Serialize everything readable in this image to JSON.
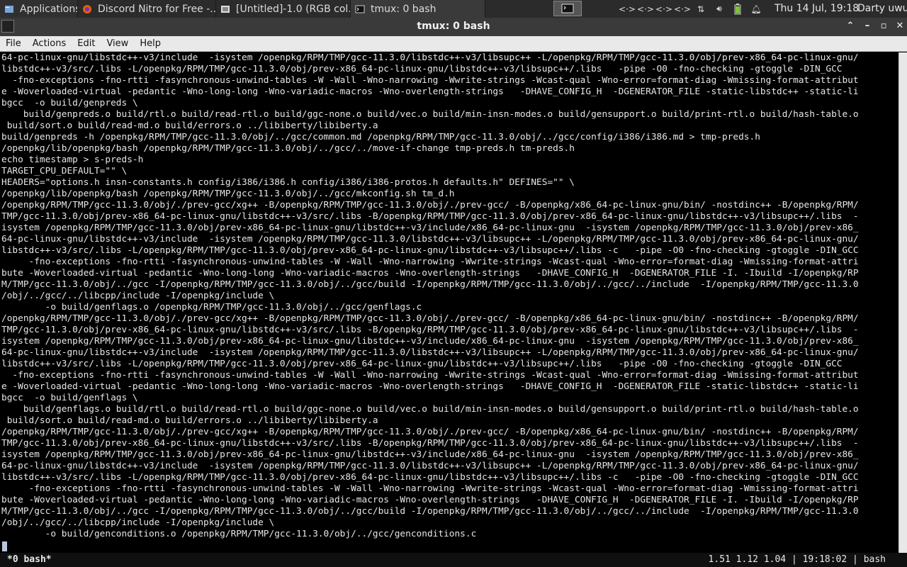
{
  "panel": {
    "apps_label": "Applications",
    "tasks": [
      {
        "label": "Discord Nitro for Free -..."
      },
      {
        "label": "[Untitled]-1.0 (RGB col..."
      },
      {
        "label": "tmux: 0 bash"
      }
    ],
    "clock": "Thu 14 Jul, 19:18",
    "user": "Darty uwu"
  },
  "window": {
    "title": "tmux: 0 bash",
    "menu": [
      "File",
      "Actions",
      "Edit",
      "View",
      "Help"
    ]
  },
  "terminal": {
    "lines": [
      "64-pc-linux-gnu/libstdc++-v3/include  -isystem /openpkg/RPM/TMP/gcc-11.3.0/libstdc++-v3/libsupc++ -L/openpkg/RPM/TMP/gcc-11.3.0/obj/prev-x86_64-pc-linux-gnu/",
      "libstdc++-v3/src/.libs -L/openpkg/RPM/TMP/gcc-11.3.0/obj/prev-x86_64-pc-linux-gnu/libstdc++-v3/libsupc++/.libs   -pipe -O0 -fno-checking -gtoggle -DIN_GCC",
      "  -fno-exceptions -fno-rtti -fasynchronous-unwind-tables -W -Wall -Wno-narrowing -Wwrite-strings -Wcast-qual -Wno-error=format-diag -Wmissing-format-attribut",
      "e -Woverloaded-virtual -pedantic -Wno-long-long -Wno-variadic-macros -Wno-overlength-strings   -DHAVE_CONFIG_H  -DGENERATOR_FILE -static-libstdc++ -static-li",
      "bgcc  -o build/genpreds \\",
      "    build/genpreds.o build/rtl.o build/read-rtl.o build/ggc-none.o build/vec.o build/min-insn-modes.o build/gensupport.o build/print-rtl.o build/hash-table.o",
      " build/sort.o build/read-md.o build/errors.o ../libiberty/libiberty.a",
      "build/genpreds -h /openpkg/RPM/TMP/gcc-11.3.0/obj/../gcc/common.md /openpkg/RPM/TMP/gcc-11.3.0/obj/../gcc/config/i386/i386.md > tmp-preds.h",
      "/openpkg/lib/openpkg/bash /openpkg/RPM/TMP/gcc-11.3.0/obj/../gcc/../move-if-change tmp-preds.h tm-preds.h",
      "echo timestamp > s-preds-h",
      "TARGET_CPU_DEFAULT=\"\" \\",
      "HEADERS=\"options.h insn-constants.h config/i386/i386.h config/i386/i386-protos.h defaults.h\" DEFINES=\"\" \\",
      "/openpkg/lib/openpkg/bash /openpkg/RPM/TMP/gcc-11.3.0/obj/../gcc/mkconfig.sh tm_d.h",
      "/openpkg/RPM/TMP/gcc-11.3.0/obj/./prev-gcc/xg++ -B/openpkg/RPM/TMP/gcc-11.3.0/obj/./prev-gcc/ -B/openpkg/x86_64-pc-linux-gnu/bin/ -nostdinc++ -B/openpkg/RPM/",
      "TMP/gcc-11.3.0/obj/prev-x86_64-pc-linux-gnu/libstdc++-v3/src/.libs -B/openpkg/RPM/TMP/gcc-11.3.0/obj/prev-x86_64-pc-linux-gnu/libstdc++-v3/libsupc++/.libs  -",
      "isystem /openpkg/RPM/TMP/gcc-11.3.0/obj/prev-x86_64-pc-linux-gnu/libstdc++-v3/include/x86_64-pc-linux-gnu  -isystem /openpkg/RPM/TMP/gcc-11.3.0/obj/prev-x86_",
      "64-pc-linux-gnu/libstdc++-v3/include  -isystem /openpkg/RPM/TMP/gcc-11.3.0/libstdc++-v3/libsupc++ -L/openpkg/RPM/TMP/gcc-11.3.0/obj/prev-x86_64-pc-linux-gnu/",
      "libstdc++-v3/src/.libs -L/openpkg/RPM/TMP/gcc-11.3.0/obj/prev-x86_64-pc-linux-gnu/libstdc++-v3/libsupc++/.libs -c   -pipe -O0 -fno-checking -gtoggle -DIN_GCC",
      "     -fno-exceptions -fno-rtti -fasynchronous-unwind-tables -W -Wall -Wno-narrowing -Wwrite-strings -Wcast-qual -Wno-error=format-diag -Wmissing-format-attri",
      "bute -Woverloaded-virtual -pedantic -Wno-long-long -Wno-variadic-macros -Wno-overlength-strings   -DHAVE_CONFIG_H  -DGENERATOR_FILE -I. -Ibuild -I/openpkg/RP",
      "M/TMP/gcc-11.3.0/obj/../gcc -I/openpkg/RPM/TMP/gcc-11.3.0/obj/../gcc/build -I/openpkg/RPM/TMP/gcc-11.3.0/obj/../gcc/../include  -I/openpkg/RPM/TMP/gcc-11.3.0",
      "/obj/../gcc/../libcpp/include -I/openpkg/include \\",
      "        -o build/genflags.o /openpkg/RPM/TMP/gcc-11.3.0/obj/../gcc/genflags.c",
      "/openpkg/RPM/TMP/gcc-11.3.0/obj/./prev-gcc/xg++ -B/openpkg/RPM/TMP/gcc-11.3.0/obj/./prev-gcc/ -B/openpkg/x86_64-pc-linux-gnu/bin/ -nostdinc++ -B/openpkg/RPM/",
      "TMP/gcc-11.3.0/obj/prev-x86_64-pc-linux-gnu/libstdc++-v3/src/.libs -B/openpkg/RPM/TMP/gcc-11.3.0/obj/prev-x86_64-pc-linux-gnu/libstdc++-v3/libsupc++/.libs  -",
      "isystem /openpkg/RPM/TMP/gcc-11.3.0/obj/prev-x86_64-pc-linux-gnu/libstdc++-v3/include/x86_64-pc-linux-gnu  -isystem /openpkg/RPM/TMP/gcc-11.3.0/obj/prev-x86_",
      "64-pc-linux-gnu/libstdc++-v3/include  -isystem /openpkg/RPM/TMP/gcc-11.3.0/libstdc++-v3/libsupc++ -L/openpkg/RPM/TMP/gcc-11.3.0/obj/prev-x86_64-pc-linux-gnu/",
      "libstdc++-v3/src/.libs -L/openpkg/RPM/TMP/gcc-11.3.0/obj/prev-x86_64-pc-linux-gnu/libstdc++-v3/libsupc++/.libs   -pipe -O0 -fno-checking -gtoggle -DIN_GCC",
      "  -fno-exceptions -fno-rtti -fasynchronous-unwind-tables -W -Wall -Wno-narrowing -Wwrite-strings -Wcast-qual -Wno-error=format-diag -Wmissing-format-attribut",
      "e -Woverloaded-virtual -pedantic -Wno-long-long -Wno-variadic-macros -Wno-overlength-strings   -DHAVE_CONFIG_H  -DGENERATOR_FILE -static-libstdc++ -static-li",
      "bgcc  -o build/genflags \\",
      "    build/genflags.o build/rtl.o build/read-rtl.o build/ggc-none.o build/vec.o build/min-insn-modes.o build/gensupport.o build/print-rtl.o build/hash-table.o",
      " build/sort.o build/read-md.o build/errors.o ../libiberty/libiberty.a",
      "/openpkg/RPM/TMP/gcc-11.3.0/obj/./prev-gcc/xg++ -B/openpkg/RPM/TMP/gcc-11.3.0/obj/./prev-gcc/ -B/openpkg/x86_64-pc-linux-gnu/bin/ -nostdinc++ -B/openpkg/RPM/",
      "TMP/gcc-11.3.0/obj/prev-x86_64-pc-linux-gnu/libstdc++-v3/src/.libs -B/openpkg/RPM/TMP/gcc-11.3.0/obj/prev-x86_64-pc-linux-gnu/libstdc++-v3/libsupc++/.libs  -",
      "isystem /openpkg/RPM/TMP/gcc-11.3.0/obj/prev-x86_64-pc-linux-gnu/libstdc++-v3/include/x86_64-pc-linux-gnu  -isystem /openpkg/RPM/TMP/gcc-11.3.0/obj/prev-x86_",
      "64-pc-linux-gnu/libstdc++-v3/include  -isystem /openpkg/RPM/TMP/gcc-11.3.0/libstdc++-v3/libsupc++ -L/openpkg/RPM/TMP/gcc-11.3.0/obj/prev-x86_64-pc-linux-gnu/",
      "libstdc++-v3/src/.libs -L/openpkg/RPM/TMP/gcc-11.3.0/obj/prev-x86_64-pc-linux-gnu/libstdc++-v3/libsupc++/.libs -c   -pipe -O0 -fno-checking -gtoggle -DIN_GCC",
      "     -fno-exceptions -fno-rtti -fasynchronous-unwind-tables -W -Wall -Wno-narrowing -Wwrite-strings -Wcast-qual -Wno-error=format-diag -Wmissing-format-attri",
      "bute -Woverloaded-virtual -pedantic -Wno-long-long -Wno-variadic-macros -Wno-overlength-strings   -DHAVE_CONFIG_H  -DGENERATOR_FILE -I. -Ibuild -I/openpkg/RP",
      "M/TMP/gcc-11.3.0/obj/../gcc -I/openpkg/RPM/TMP/gcc-11.3.0/obj/../gcc/build -I/openpkg/RPM/TMP/gcc-11.3.0/obj/../gcc/../include  -I/openpkg/RPM/TMP/gcc-11.3.0",
      "/obj/../gcc/../libcpp/include -I/openpkg/include \\",
      "        -o build/genconditions.o /openpkg/RPM/TMP/gcc-11.3.0/obj/../gcc/genconditions.c"
    ]
  },
  "status": {
    "left": "*0 bash*",
    "right": "1.51 1.12 1.04 | 19:18:02 | bash"
  },
  "colors": {
    "panel_bg": "#2b2b2b",
    "terminal_bg": "#000000",
    "terminal_fg": "#e6e6e6"
  },
  "icons": [
    "app-menu-icon",
    "firefox-icon",
    "gimp-icon",
    "terminal-icon",
    "network-icon",
    "volume-icon",
    "battery-icon",
    "bell-icon"
  ]
}
